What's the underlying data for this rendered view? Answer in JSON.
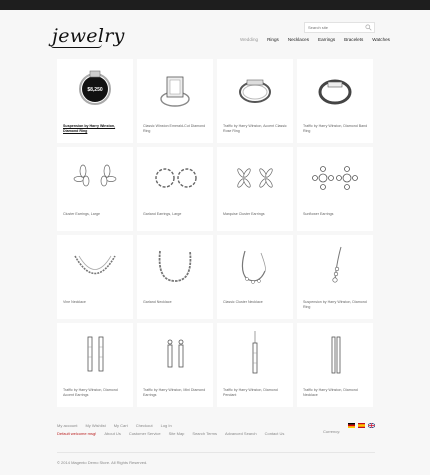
{
  "header": {
    "logo": "jewelry",
    "search_placeholder": "Search site",
    "nav": [
      "Wedding",
      "Rings",
      "Necklaces",
      "Earrings",
      "Bracelets",
      "Watches"
    ]
  },
  "products": [
    {
      "caption": "Suspension by Harry Winston, Diamond Ring",
      "badge": "$8,250"
    },
    {
      "caption": "Classic Winston Emerald-Cut Diamond Ring"
    },
    {
      "caption": "Traffic by Harry Winston, Accent Classic Rose Ring"
    },
    {
      "caption": "Traffic by Harry Winston, Diamond Band Ring"
    },
    {
      "caption": "Cluster Earrings, Large"
    },
    {
      "caption": "Garland Earrings, Large"
    },
    {
      "caption": "Marquise Cluster Earrings"
    },
    {
      "caption": "Sunflower Earrings"
    },
    {
      "caption": "Vine Necklace"
    },
    {
      "caption": "Garland Necklace"
    },
    {
      "caption": "Classic Cluster Necklace"
    },
    {
      "caption": "Suspension by Harry Winston, Diamond Ring"
    },
    {
      "caption": "Traffic by Harry Winston, Diamond Accent Earrings"
    },
    {
      "caption": "Traffic by Harry Winston, Mini Diamond Earrings"
    },
    {
      "caption": "Traffic by Harry Winston, Diamond Pendant"
    },
    {
      "caption": "Traffic by Harry Winston, Diamond Necklace"
    }
  ],
  "footer": {
    "links_row1": [
      "My account",
      "My Wishlist",
      "My Cart",
      "Checkout",
      "Log In"
    ],
    "links_row2": [
      "Default welcome msg!",
      "About Us",
      "Customer Service",
      "Site Map",
      "Search Terms",
      "Advanced Search",
      "Contact Us"
    ],
    "currency": "Currency:",
    "copyright": "© 2014 Magento Demo Store. All Rights Reserved."
  },
  "colors": {
    "topbar": "#1e1e1e",
    "accent_red": "#b22222",
    "card_bg": "#ffffff"
  }
}
